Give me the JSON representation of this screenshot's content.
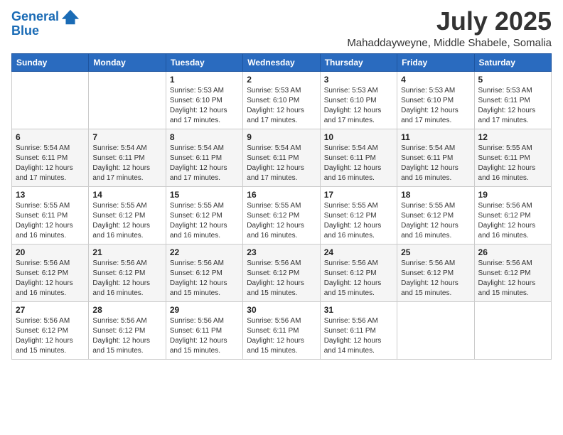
{
  "header": {
    "logo_line1": "General",
    "logo_line2": "Blue",
    "month": "July 2025",
    "location": "Mahaddayweyne, Middle Shabele, Somalia"
  },
  "weekdays": [
    "Sunday",
    "Monday",
    "Tuesday",
    "Wednesday",
    "Thursday",
    "Friday",
    "Saturday"
  ],
  "weeks": [
    [
      {
        "day": "",
        "info": ""
      },
      {
        "day": "",
        "info": ""
      },
      {
        "day": "1",
        "info": "Sunrise: 5:53 AM\nSunset: 6:10 PM\nDaylight: 12 hours and 17 minutes."
      },
      {
        "day": "2",
        "info": "Sunrise: 5:53 AM\nSunset: 6:10 PM\nDaylight: 12 hours and 17 minutes."
      },
      {
        "day": "3",
        "info": "Sunrise: 5:53 AM\nSunset: 6:10 PM\nDaylight: 12 hours and 17 minutes."
      },
      {
        "day": "4",
        "info": "Sunrise: 5:53 AM\nSunset: 6:10 PM\nDaylight: 12 hours and 17 minutes."
      },
      {
        "day": "5",
        "info": "Sunrise: 5:53 AM\nSunset: 6:11 PM\nDaylight: 12 hours and 17 minutes."
      }
    ],
    [
      {
        "day": "6",
        "info": "Sunrise: 5:54 AM\nSunset: 6:11 PM\nDaylight: 12 hours and 17 minutes."
      },
      {
        "day": "7",
        "info": "Sunrise: 5:54 AM\nSunset: 6:11 PM\nDaylight: 12 hours and 17 minutes."
      },
      {
        "day": "8",
        "info": "Sunrise: 5:54 AM\nSunset: 6:11 PM\nDaylight: 12 hours and 17 minutes."
      },
      {
        "day": "9",
        "info": "Sunrise: 5:54 AM\nSunset: 6:11 PM\nDaylight: 12 hours and 17 minutes."
      },
      {
        "day": "10",
        "info": "Sunrise: 5:54 AM\nSunset: 6:11 PM\nDaylight: 12 hours and 16 minutes."
      },
      {
        "day": "11",
        "info": "Sunrise: 5:54 AM\nSunset: 6:11 PM\nDaylight: 12 hours and 16 minutes."
      },
      {
        "day": "12",
        "info": "Sunrise: 5:55 AM\nSunset: 6:11 PM\nDaylight: 12 hours and 16 minutes."
      }
    ],
    [
      {
        "day": "13",
        "info": "Sunrise: 5:55 AM\nSunset: 6:11 PM\nDaylight: 12 hours and 16 minutes."
      },
      {
        "day": "14",
        "info": "Sunrise: 5:55 AM\nSunset: 6:12 PM\nDaylight: 12 hours and 16 minutes."
      },
      {
        "day": "15",
        "info": "Sunrise: 5:55 AM\nSunset: 6:12 PM\nDaylight: 12 hours and 16 minutes."
      },
      {
        "day": "16",
        "info": "Sunrise: 5:55 AM\nSunset: 6:12 PM\nDaylight: 12 hours and 16 minutes."
      },
      {
        "day": "17",
        "info": "Sunrise: 5:55 AM\nSunset: 6:12 PM\nDaylight: 12 hours and 16 minutes."
      },
      {
        "day": "18",
        "info": "Sunrise: 5:55 AM\nSunset: 6:12 PM\nDaylight: 12 hours and 16 minutes."
      },
      {
        "day": "19",
        "info": "Sunrise: 5:56 AM\nSunset: 6:12 PM\nDaylight: 12 hours and 16 minutes."
      }
    ],
    [
      {
        "day": "20",
        "info": "Sunrise: 5:56 AM\nSunset: 6:12 PM\nDaylight: 12 hours and 16 minutes."
      },
      {
        "day": "21",
        "info": "Sunrise: 5:56 AM\nSunset: 6:12 PM\nDaylight: 12 hours and 16 minutes."
      },
      {
        "day": "22",
        "info": "Sunrise: 5:56 AM\nSunset: 6:12 PM\nDaylight: 12 hours and 15 minutes."
      },
      {
        "day": "23",
        "info": "Sunrise: 5:56 AM\nSunset: 6:12 PM\nDaylight: 12 hours and 15 minutes."
      },
      {
        "day": "24",
        "info": "Sunrise: 5:56 AM\nSunset: 6:12 PM\nDaylight: 12 hours and 15 minutes."
      },
      {
        "day": "25",
        "info": "Sunrise: 5:56 AM\nSunset: 6:12 PM\nDaylight: 12 hours and 15 minutes."
      },
      {
        "day": "26",
        "info": "Sunrise: 5:56 AM\nSunset: 6:12 PM\nDaylight: 12 hours and 15 minutes."
      }
    ],
    [
      {
        "day": "27",
        "info": "Sunrise: 5:56 AM\nSunset: 6:12 PM\nDaylight: 12 hours and 15 minutes."
      },
      {
        "day": "28",
        "info": "Sunrise: 5:56 AM\nSunset: 6:12 PM\nDaylight: 12 hours and 15 minutes."
      },
      {
        "day": "29",
        "info": "Sunrise: 5:56 AM\nSunset: 6:11 PM\nDaylight: 12 hours and 15 minutes."
      },
      {
        "day": "30",
        "info": "Sunrise: 5:56 AM\nSunset: 6:11 PM\nDaylight: 12 hours and 15 minutes."
      },
      {
        "day": "31",
        "info": "Sunrise: 5:56 AM\nSunset: 6:11 PM\nDaylight: 12 hours and 14 minutes."
      },
      {
        "day": "",
        "info": ""
      },
      {
        "day": "",
        "info": ""
      }
    ]
  ]
}
